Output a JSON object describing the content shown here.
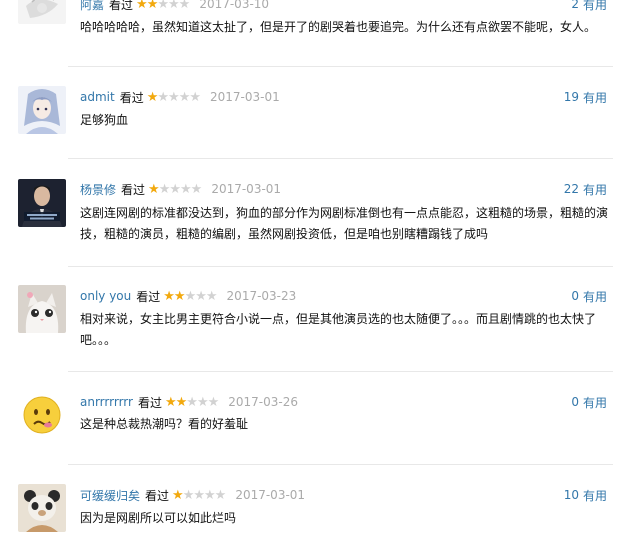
{
  "comments": [
    {
      "author": "阿嘉",
      "watched": "看过",
      "rating": 2,
      "date": "2017-03-10",
      "votes": "2",
      "votes_label": "有用",
      "text": "哈哈哈哈哈，虽然知道这太扯了，但是开了的剧哭着也要追完。为什么还有点欲罢不能呢，女人。"
    },
    {
      "author": "admit",
      "watched": "看过",
      "rating": 1,
      "date": "2017-03-01",
      "votes": "19",
      "votes_label": "有用",
      "text": "足够狗血"
    },
    {
      "author": "杨景修",
      "watched": "看过",
      "rating": 1,
      "date": "2017-03-01",
      "votes": "22",
      "votes_label": "有用",
      "text": "这剧连网剧的标准都没达到，狗血的部分作为网剧标准倒也有一点点能忍，这粗糙的场景，粗糙的演技，粗糙的演员，粗糙的编剧，虽然网剧投资低，但是咱也别瞎糟蹋钱了成吗"
    },
    {
      "author": "only you",
      "watched": "看过",
      "rating": 2,
      "date": "2017-03-23",
      "votes": "0",
      "votes_label": "有用",
      "text": "相对来说，女主比男主更符合小说一点，但是其他演员选的也太随便了。。。而且剧情跳的也太快了吧。。。"
    },
    {
      "author": "anrrrrrrrr",
      "watched": "看过",
      "rating": 2,
      "date": "2017-03-26",
      "votes": "0",
      "votes_label": "有用",
      "text": "这是种总裁热潮吗？看的好羞耻"
    },
    {
      "author": "可缓缓归矣",
      "watched": "看过",
      "rating": 1,
      "date": "2017-03-01",
      "votes": "10",
      "votes_label": "有用",
      "text": "因为是网剧所以可以如此烂吗"
    }
  ],
  "avatars": [
    "sketch-portrait",
    "anime-girl",
    "man-in-suit",
    "white-cat",
    "confused-emoji",
    "bear-doll"
  ],
  "colors": {
    "link": "#3377aa",
    "star_on": "#f2a90e",
    "star_off": "#d2d2d2",
    "date": "#aaaaaa"
  }
}
